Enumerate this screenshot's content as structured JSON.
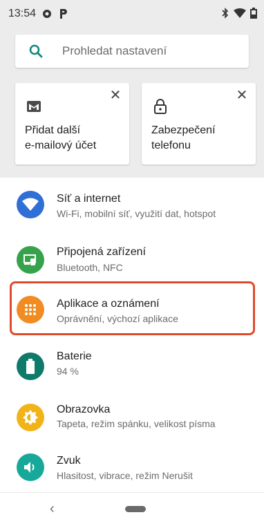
{
  "status": {
    "time": "13:54"
  },
  "search": {
    "placeholder": "Prohledat nastavení"
  },
  "cards": [
    {
      "line1": "Přidat další",
      "line2": "e-mailový účet",
      "icon": "mail-icon",
      "close": "✕"
    },
    {
      "line1": "Zabezpečení",
      "line2": "telefonu",
      "icon": "lock-icon",
      "close": "✕"
    }
  ],
  "settings": [
    {
      "title": "Síť a internet",
      "subtitle": "Wi-Fi, mobilní síť, využití dat, hotspot",
      "color": "#2f6fd6",
      "icon": "wifi-icon"
    },
    {
      "title": "Připojená zařízení",
      "subtitle": "Bluetooth, NFC",
      "color": "#36a24b",
      "icon": "devices-icon"
    },
    {
      "title": "Aplikace a oznámení",
      "subtitle": "Oprávnění, výchozí aplikace",
      "color": "#f08c22",
      "icon": "apps-grid-icon"
    },
    {
      "title": "Baterie",
      "subtitle": "94 %",
      "color": "#0e7a6a",
      "icon": "battery-icon"
    },
    {
      "title": "Obrazovka",
      "subtitle": "Tapeta, režim spánku, velikost písma",
      "color": "#f2b319",
      "icon": "brightness-icon"
    },
    {
      "title": "Zvuk",
      "subtitle": "Hlasitost, vibrace, režim Nerušit",
      "color": "#16a898",
      "icon": "volume-icon"
    }
  ],
  "nav": {
    "back": "‹"
  }
}
